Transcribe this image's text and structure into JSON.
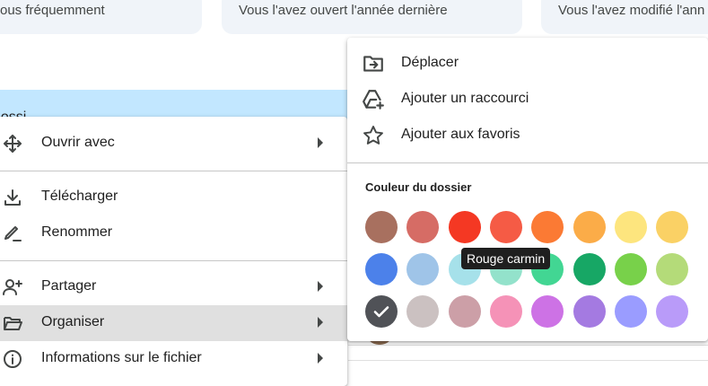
{
  "background_cards": [
    {
      "text": "ous fréquemment"
    },
    {
      "text": "Vous l'avez ouvert l'année dernière"
    },
    {
      "text": "Vous l'avez modifié l'ann"
    }
  ],
  "selected_row_text": "dossi",
  "context_menu": {
    "items": [
      {
        "label": "Ouvrir avec",
        "icon": "move-arrows-icon",
        "submenu": true
      },
      {
        "label": "Télécharger",
        "icon": "download-icon",
        "submenu": false
      },
      {
        "label": "Renommer",
        "icon": "rename-pencil-icon",
        "submenu": false
      },
      {
        "label": "Partager",
        "icon": "share-person-add-icon",
        "submenu": true
      },
      {
        "label": "Organiser",
        "icon": "folder-open-icon",
        "submenu": true,
        "highlighted": true
      },
      {
        "label": "Informations sur le fichier",
        "icon": "info-icon",
        "submenu": true
      }
    ]
  },
  "organize_submenu": {
    "items": [
      {
        "label": "Déplacer",
        "icon": "move-to-folder-icon"
      },
      {
        "label": "Ajouter un raccourci",
        "icon": "add-shortcut-drive-icon"
      },
      {
        "label": "Ajouter aux favoris",
        "icon": "star-outline-icon"
      }
    ],
    "color_section_title": "Couleur du dossier",
    "colors": [
      [
        "#a8705f",
        "#d66c65",
        "#f43823",
        "#f55b45",
        "#fb7a34",
        "#fbac48",
        "#fde57e",
        "#fad165"
      ],
      [
        "#4c81ea",
        "#9fc4e8",
        "#a6e1ea",
        "#93e2cb",
        "#42d693",
        "#17a765",
        "#78d14a",
        "#b4db79"
      ],
      [
        "#505257",
        "#cbc1c1",
        "#cc9fa7",
        "#f592b7",
        "#cd72e5",
        "#a47ae1",
        "#9a9cff",
        "#b99bf9"
      ]
    ],
    "selected_color": "#505257",
    "hovered_color": "#f43823",
    "tooltip": "Rouge carmin"
  }
}
